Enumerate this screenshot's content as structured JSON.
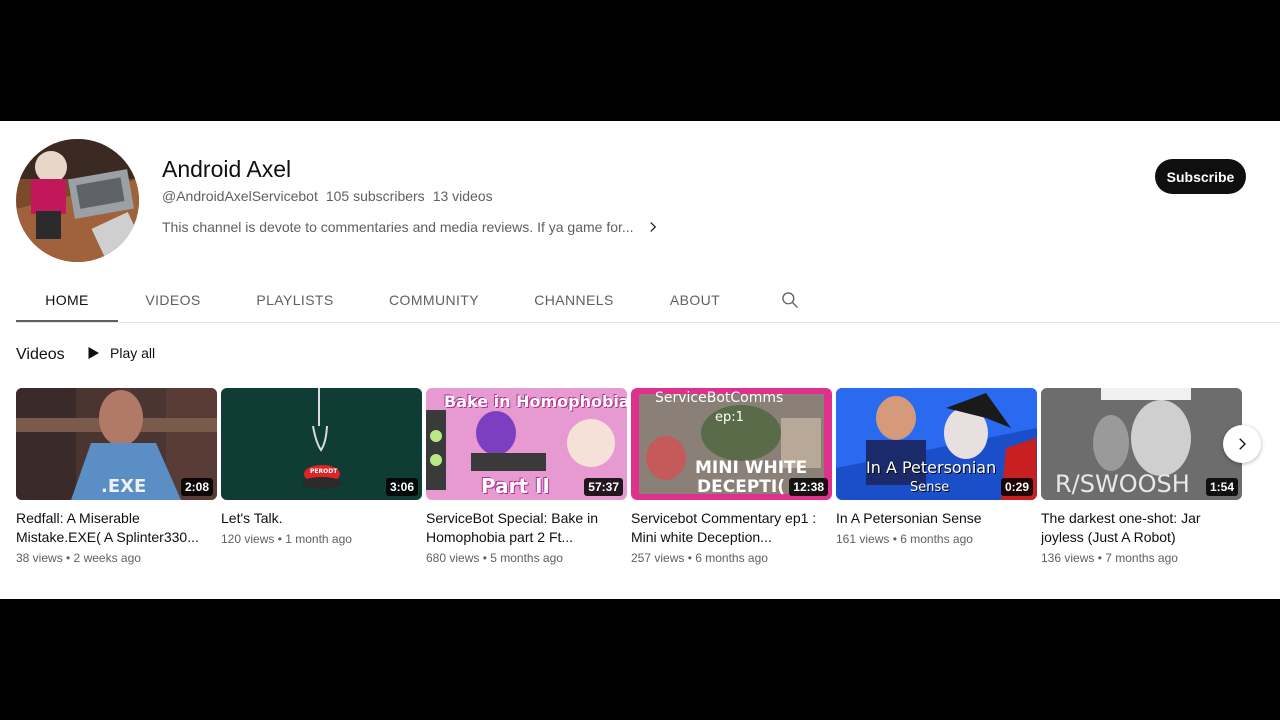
{
  "channel": {
    "name": "Android Axel",
    "handle": "@AndroidAxelServicebot",
    "subscribers": "105 subscribers",
    "videos_count": "13 videos",
    "description": "This channel is devote to commentaries and media reviews. If ya game for...",
    "subscribe_label": "Subscribe"
  },
  "tabs": [
    {
      "label": "HOME"
    },
    {
      "label": "VIDEOS"
    },
    {
      "label": "PLAYLISTS"
    },
    {
      "label": "COMMUNITY"
    },
    {
      "label": "CHANNELS"
    },
    {
      "label": "ABOUT"
    }
  ],
  "section": {
    "title": "Videos",
    "play_all": "Play all"
  },
  "videos": [
    {
      "title": "Redfall: A Miserable Mistake.EXE( A Splinter330...",
      "duration": "2:08",
      "views": "38 views",
      "age": "2 weeks ago",
      "meta": "38 views • 2 weeks ago",
      "overlay_text": ".EXE"
    },
    {
      "title": "Let's Talk.",
      "duration": "3:06",
      "views": "120 views",
      "age": "1 month ago",
      "meta": "120 views • 1 month ago",
      "overlay_text": "PERODT"
    },
    {
      "title": "ServiceBot Special: Bake in Homophobia part 2 Ft...",
      "duration": "57:37",
      "views": "680 views",
      "age": "5 months ago",
      "meta": "680 views • 5 months ago",
      "overlay_text": "Bake in Homophobia",
      "overlay_text2": "Part II"
    },
    {
      "title": "Servicebot Commentary ep1 : Mini white Deception...",
      "duration": "12:38",
      "views": "257 views",
      "age": "6 months ago",
      "meta": "257 views • 6 months ago",
      "overlay_text": "ServiceBotComms",
      "overlay_text2": "ep:1",
      "overlay_text3": "MINI WHITE",
      "overlay_text4": "DECEPTI("
    },
    {
      "title": "In A Petersonian Sense",
      "duration": "0:29",
      "views": "161 views",
      "age": "6 months ago",
      "meta": "161 views • 6 months ago",
      "overlay_text": "In A Petersonian",
      "overlay_text2": "Sense"
    },
    {
      "title": "The darkest one-shot: Jar joyless (Just A Robot)",
      "duration": "1:54",
      "views": "136 views",
      "age": "7 months ago",
      "meta": "136 views • 7 months ago",
      "overlay_text": "R/SWOOSH"
    }
  ],
  "icons": {
    "search": "search-icon",
    "play": "play-icon",
    "chevron_right": "chevron-right-icon",
    "next": "chevron-right-icon"
  },
  "colors": {
    "subscribe_bg": "#0f0f0f",
    "text_primary": "#0f0f0f",
    "text_secondary": "#606060"
  }
}
